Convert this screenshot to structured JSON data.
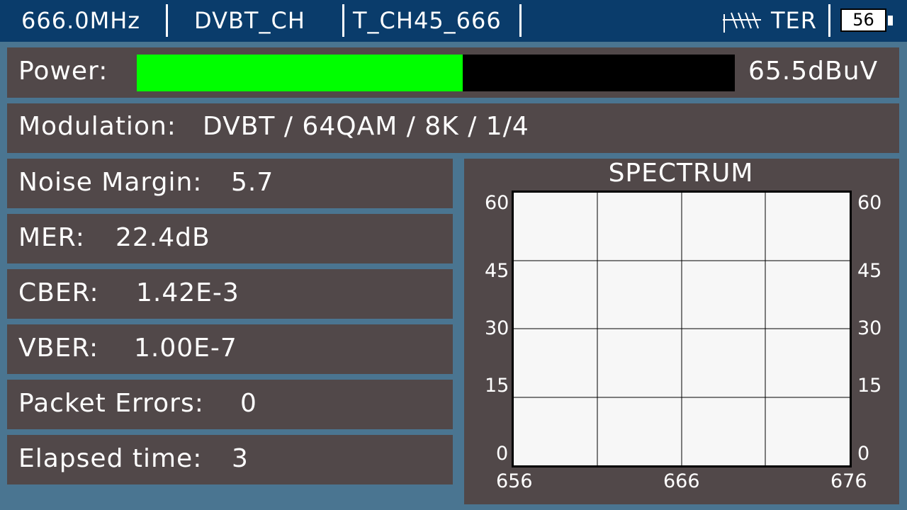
{
  "header": {
    "frequency": "666.0MHz",
    "standard": "DVBT_CH",
    "channel": "T_CH45_666",
    "band": "TER",
    "battery": "56"
  },
  "power": {
    "label": "Power:",
    "value": "65.5dBuV",
    "level_fraction": 0.545,
    "bar_color": "#00ff00"
  },
  "modulation": {
    "label": "Modulation:",
    "value": "DVBT / 64QAM / 8K / 1/4"
  },
  "measurements": [
    {
      "label": "Noise Margin:",
      "value": "5.7"
    },
    {
      "label": "MER:",
      "value": "22.4dB"
    },
    {
      "label": "CBER:",
      "value": "1.42E-3"
    },
    {
      "label": "VBER:",
      "value": "1.00E-7"
    },
    {
      "label": "Packet Errors:",
      "value": "0"
    },
    {
      "label": "Elapsed time:",
      "value": "3"
    }
  ],
  "spectrum": {
    "title": "SPECTRUM",
    "y_ticks": [
      "60",
      "45",
      "30",
      "15",
      "0"
    ],
    "x_ticks": [
      "656",
      "666",
      "676"
    ]
  }
}
